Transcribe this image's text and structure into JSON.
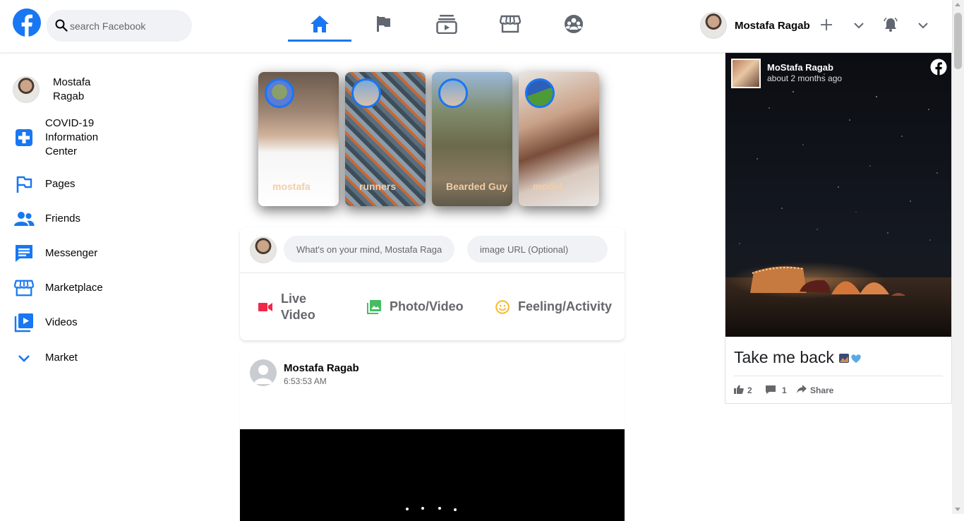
{
  "header": {
    "search_placeholder": "search Facebook",
    "nav_tabs": [
      {
        "icon": "home-icon",
        "active": true
      },
      {
        "icon": "flag-icon",
        "active": false
      },
      {
        "icon": "watch-icon",
        "active": false
      },
      {
        "icon": "marketplace-icon",
        "active": false
      },
      {
        "icon": "groups-icon",
        "active": false
      }
    ],
    "user_name": "Mostafa Ragab",
    "accent_color": "#1877f2"
  },
  "sidebar": {
    "user_name": "Mostafa Ragab",
    "items": [
      {
        "label": "COVID-19 Information Center",
        "icon": "covid-plus-icon"
      },
      {
        "label": "Pages",
        "icon": "pages-flag-icon"
      },
      {
        "label": "Friends",
        "icon": "friends-icon"
      },
      {
        "label": "Messenger",
        "icon": "messenger-icon"
      },
      {
        "label": "Marketplace",
        "icon": "marketplace-icon"
      },
      {
        "label": "Videos",
        "icon": "videos-icon"
      },
      {
        "label": "Market",
        "icon": "chevron-down-icon"
      }
    ]
  },
  "stories": [
    {
      "name": "mostafa"
    },
    {
      "name": "runners"
    },
    {
      "name": "Bearded Guy"
    },
    {
      "name": "model"
    }
  ],
  "composer": {
    "mind_placeholder": "What's on your mind, Mostafa Ragab",
    "image_placeholder": "image URL (Optional)",
    "actions": [
      {
        "label": "Live Video",
        "icon": "live-video-icon",
        "color": "#f02849"
      },
      {
        "label": "Photo/Video",
        "icon": "photo-icon",
        "color": "#45bd62"
      },
      {
        "label": "Feeling/Activity",
        "icon": "feeling-icon",
        "color": "#f7b928"
      }
    ]
  },
  "post": {
    "author": "Mostafa Ragab",
    "time": "6:53:53 AM"
  },
  "right_card": {
    "author": "MoStafa Ragab",
    "time": "about 2 months ago",
    "caption": "Take me back",
    "likes": "2",
    "comments": "1",
    "share_label": "Share"
  }
}
